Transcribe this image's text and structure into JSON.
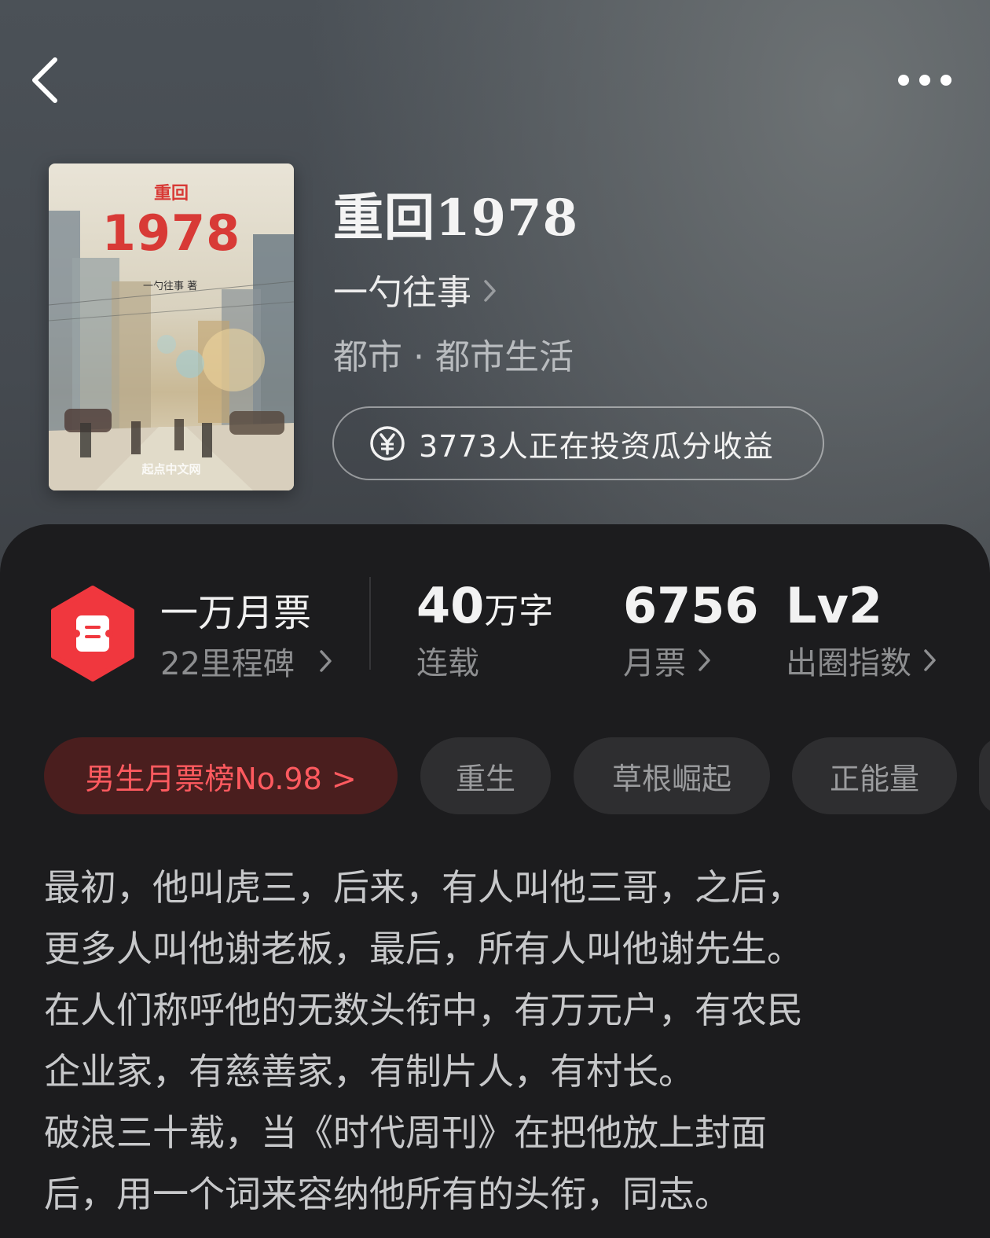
{
  "nav": {
    "back_icon": "chevron-left-icon",
    "more_icon": "more-dots-icon"
  },
  "cover": {
    "small_title": "重回",
    "big_title": "1978",
    "author_line": "一勺往事 著",
    "publisher": "起点中文网"
  },
  "book": {
    "title": "重回1978",
    "author": "一勺往事",
    "genre": "都市 · 都市生活",
    "invest_text": "3773人正在投资瓜分收益",
    "invest_icon": "yuan-coin-icon"
  },
  "stats": {
    "ticket_title": "一万月票",
    "ticket_sub": "22里程碑",
    "ticket_badge_icon": "ticket-hexagon-icon",
    "ticket_badge_color": "#f0373e",
    "words_value": "40",
    "words_unit": "万字",
    "words_label": "连载",
    "monthly_value": "6756",
    "monthly_label": "月票",
    "circle_value": "Lv2",
    "circle_label": "出圈指数"
  },
  "tags": [
    {
      "label": "男生月票榜No.98 >",
      "accent": "#ff5a5f"
    },
    {
      "label": "重生"
    },
    {
      "label": "草根崛起"
    },
    {
      "label": "正能量"
    }
  ],
  "description": [
    "最初，他叫虎三，后来，有人叫他三哥，之后，",
    "更多人叫他谢老板，最后，所有人叫他谢先生。",
    "在人们称呼他的无数头衔中，有万元户，有农民",
    "企业家，有慈善家，有制片人，有村长。",
    "破浪三十载，当《时代周刊》在把他放上封面",
    "后，用一个词来容纳他所有的头衔，同志。"
  ]
}
